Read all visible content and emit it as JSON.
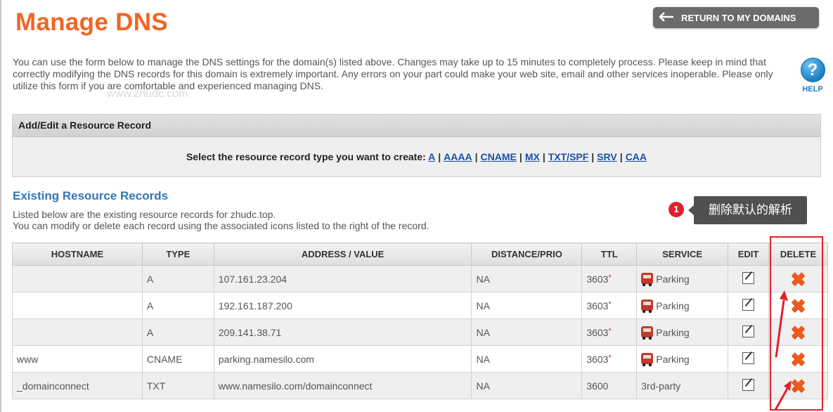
{
  "page": {
    "title": "Manage DNS",
    "return_button": "RETURN TO MY DOMAINS",
    "intro": "You can use the form below to manage the DNS settings for the domain(s) listed above. Changes may take up to 15 minutes to completely process. Please keep in mind that correctly modifying the DNS records for this domain is extremely important. Any errors on your part could make your web site, email and other services inoperable. Please only utilize this form if you are comfortable and experienced managing DNS.",
    "help_label": "HELP",
    "help_glyph": "?"
  },
  "add_edit": {
    "header": "Add/Edit a Resource Record",
    "prompt": "Select the resource record type you want to create:",
    "types": [
      "A",
      "AAAA",
      "CNAME",
      "MX",
      "TXT/SPF",
      "SRV",
      "CAA"
    ]
  },
  "existing": {
    "title": "Existing Resource Records",
    "desc_line1": "Listed below are the existing resource records for zhudc.top.",
    "desc_line2": "You can modify or delete each record using the associated icons listed to the right of the record."
  },
  "annotation": {
    "number": "1",
    "text": "删除默认的解析",
    "color": "#e0202e"
  },
  "table": {
    "headers": [
      "HOSTNAME",
      "TYPE",
      "ADDRESS / VALUE",
      "DISTANCE/PRIO",
      "TTL",
      "SERVICE",
      "EDIT",
      "DELETE"
    ],
    "rows": [
      {
        "hostname": "",
        "type": "A",
        "value": "107.161.23.204",
        "prio": "NA",
        "ttl": "3603",
        "ttl_star": "*",
        "service": "Parking",
        "service_icon": "parking-truck-icon"
      },
      {
        "hostname": "",
        "type": "A",
        "value": "192.161.187.200",
        "prio": "NA",
        "ttl": "3603",
        "ttl_star": "*",
        "service": "Parking",
        "service_icon": "parking-truck-icon"
      },
      {
        "hostname": "",
        "type": "A",
        "value": "209.141.38.71",
        "prio": "NA",
        "ttl": "3603",
        "ttl_star": "*",
        "service": "Parking",
        "service_icon": "parking-truck-icon"
      },
      {
        "hostname": "www",
        "type": "CNAME",
        "value": "parking.namesilo.com",
        "prio": "NA",
        "ttl": "3603",
        "ttl_star": "*",
        "service": "Parking",
        "service_icon": "parking-truck-icon"
      },
      {
        "hostname": "_domainconnect",
        "type": "TXT",
        "value": "www.namesilo.com/domainconnect",
        "prio": "NA",
        "ttl": "3600",
        "ttl_star": "",
        "service": "3rd-party",
        "service_icon": ""
      }
    ]
  },
  "colors": {
    "title_orange": "#f26522",
    "link_blue": "#1a4fa8",
    "section_blue": "#3176b5",
    "delete_orange": "#f05a1a"
  },
  "watermark": "www.zhudc.com"
}
